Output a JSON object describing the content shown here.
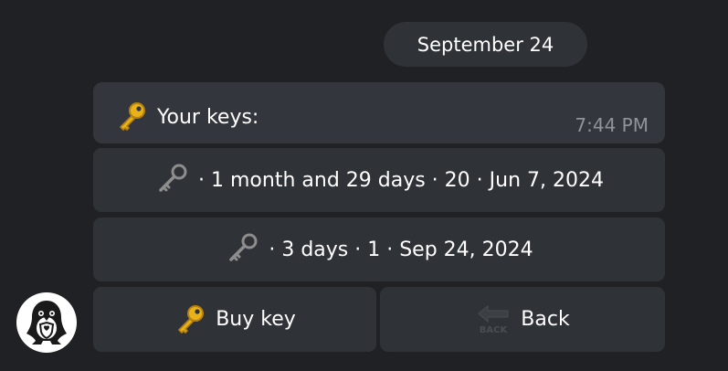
{
  "date_separator": "September 24",
  "message": {
    "text": "Your keys:",
    "icon": "gold-key-icon",
    "time": "7:44 PM"
  },
  "keyboard": {
    "rows": [
      {
        "label": "· 1 month and 29 days · 20 · Jun 7, 2024",
        "icon": "old-key-icon"
      },
      {
        "label": "· 3 days · 1 · Sep 24, 2024",
        "icon": "old-key-icon"
      }
    ],
    "buy_key": {
      "label": "Buy key",
      "icon": "gold-key-icon"
    },
    "back": {
      "label": "Back",
      "icon": "back-arrow-icon",
      "icon_text": "BACK"
    }
  },
  "avatar": {
    "icon": "penguin-shield-icon"
  },
  "colors": {
    "background": "#202124",
    "bubble": "#33363c",
    "button": "#2f3237",
    "time_text": "#8f949b",
    "gold": "#e8b21b"
  }
}
